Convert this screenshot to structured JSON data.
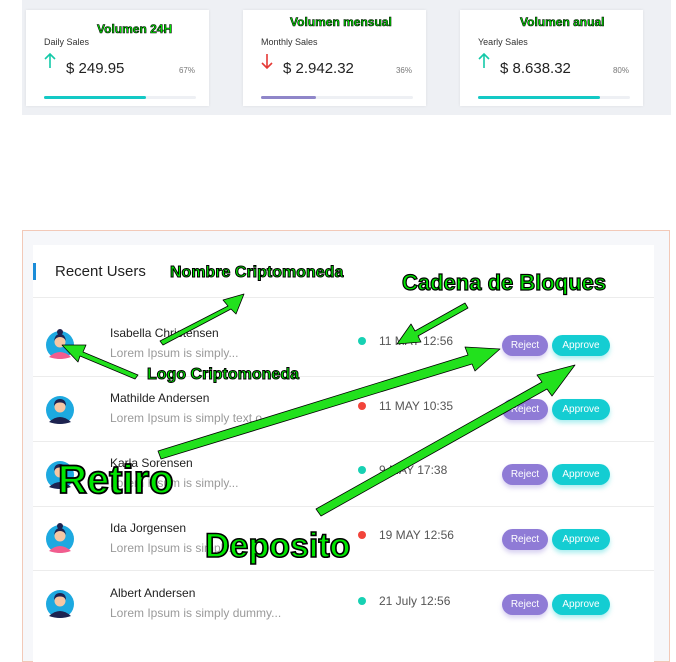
{
  "stats": [
    {
      "label": "Daily Sales",
      "value": "$ 249.95",
      "percent": "67%",
      "progress": 0.67,
      "trend": "up",
      "bar_color": "#13c9c5"
    },
    {
      "label": "Monthly Sales",
      "value": "$ 2.942.32",
      "percent": "36%",
      "progress": 0.36,
      "trend": "down",
      "bar_color": "#8f86c9"
    },
    {
      "label": "Yearly Sales",
      "value": "$ 8.638.32",
      "percent": "80%",
      "progress": 0.8,
      "trend": "up",
      "bar_color": "#13c9c5"
    }
  ],
  "panel": {
    "title": "Recent Users"
  },
  "users": [
    {
      "name": "Isabella Christensen",
      "message": "Lorem Ipsum is simply...",
      "time": "11 MAY 12:56",
      "status": "online",
      "avatar": "female-avatar-icon"
    },
    {
      "name": "Mathilde Andersen",
      "message": "Lorem Ipsum is simply text o...",
      "time": "11 MAY 10:35",
      "status": "offline",
      "avatar": "male-avatar-icon"
    },
    {
      "name": "Karla Sorensen",
      "message": "Lorem Ipsum is simply...",
      "time": "9 MAY 17:38",
      "status": "online",
      "avatar": "male-avatar-icon"
    },
    {
      "name": "Ida Jorgensen",
      "message": "Lorem Ipsum is simply...",
      "time": "19 MAY 12:56",
      "status": "offline",
      "avatar": "female-avatar-icon"
    },
    {
      "name": "Albert Andersen",
      "message": "Lorem Ipsum is simply dummy...",
      "time": "21 July 12:56",
      "status": "online",
      "avatar": "male-avatar-icon"
    }
  ],
  "buttons": {
    "reject": "Reject",
    "approve": "Approve"
  },
  "annotations": {
    "volumen_24h": "Volumen 24H",
    "volumen_mensual": "Volumen mensual",
    "volumen_anual": "Volumen anual",
    "nombre_cripto": "Nombre Criptomoneda",
    "cadena_bloques": "Cadena de Bloques",
    "logo_cripto": "Logo Criptomoneda",
    "retiro": "Retiro",
    "deposito": "Deposito"
  },
  "colors": {
    "online": "#17d1b3",
    "offline": "#f2443b",
    "up": "#13c9a8",
    "down": "#e53935",
    "accent": "#1a8cd8"
  }
}
